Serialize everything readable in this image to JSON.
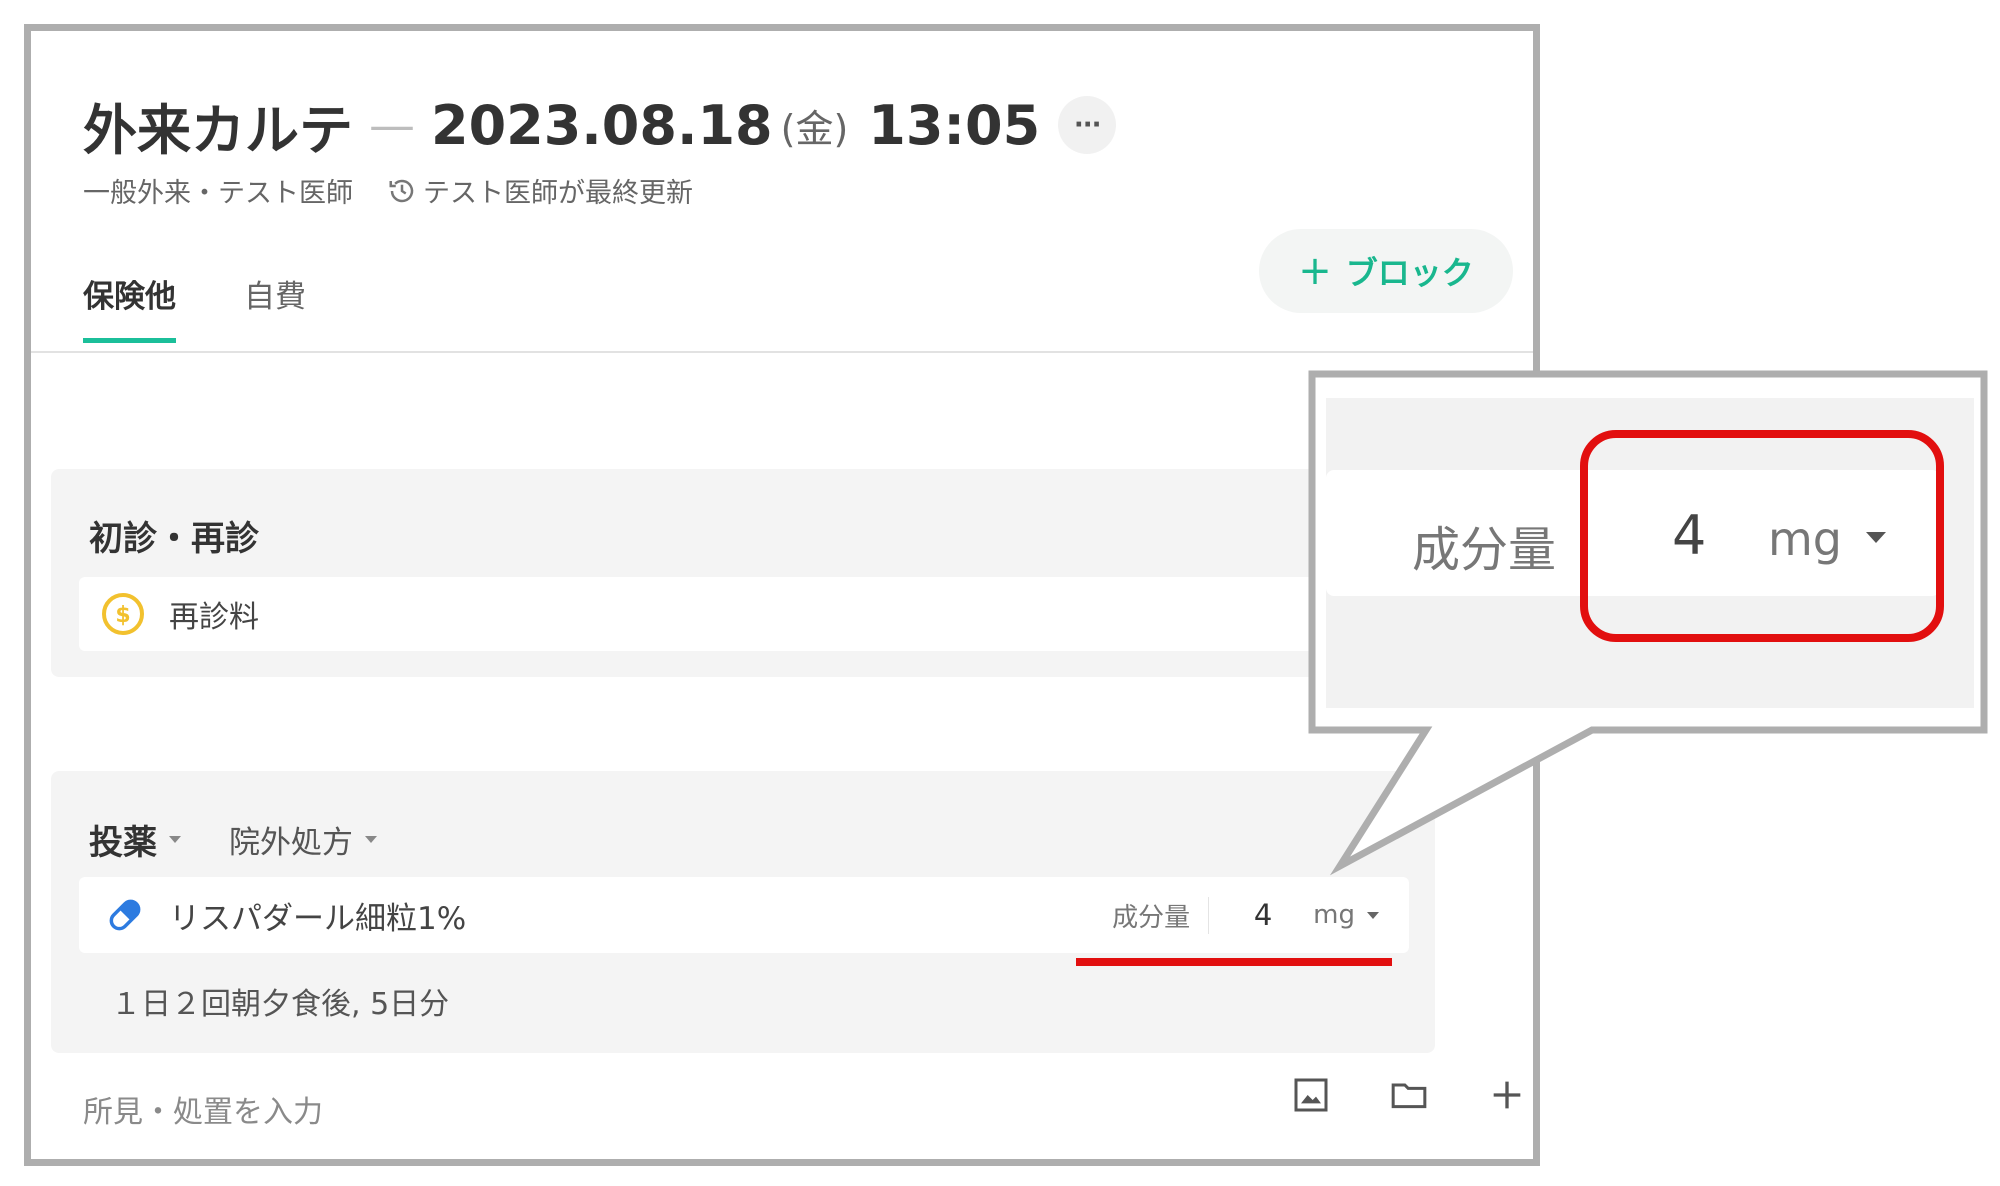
{
  "header": {
    "title": "外来カルテ",
    "dash": "—",
    "date": "2023.08.18",
    "day_of_week": "(金)",
    "time": "13:05",
    "more_label": "···",
    "subtitle_dept": "一般外来・テスト医師",
    "subtitle_updated": "テスト医師が最終更新"
  },
  "tabs": [
    {
      "label": "保険他",
      "active": true
    },
    {
      "label": "自費",
      "active": false
    }
  ],
  "add_block_button": {
    "icon": "plus-icon",
    "label": "ブロック"
  },
  "sections": {
    "visit": {
      "title": "初診・再診",
      "item_label": "再診料",
      "item_icon": "coin-icon"
    },
    "medication": {
      "category": "投薬",
      "prescription_type": "院外処方",
      "drug_name": "リスパダール細粒1%",
      "dose_label": "成分量",
      "dose_value": "4",
      "dose_unit": "mg",
      "usage": "１日２回朝夕食後, 5日分"
    }
  },
  "footer": {
    "placeholder": "所見・処置を入力",
    "icons": [
      "image-icon",
      "folder-icon",
      "plus-icon"
    ]
  },
  "callout": {
    "dose_label": "成分量",
    "dose_value": "4",
    "dose_unit": "mg"
  },
  "colors": {
    "accent": "#1bbf9a",
    "highlight": "#e20f0f",
    "coin": "#f2c12e",
    "pill": "#2d7be0"
  }
}
